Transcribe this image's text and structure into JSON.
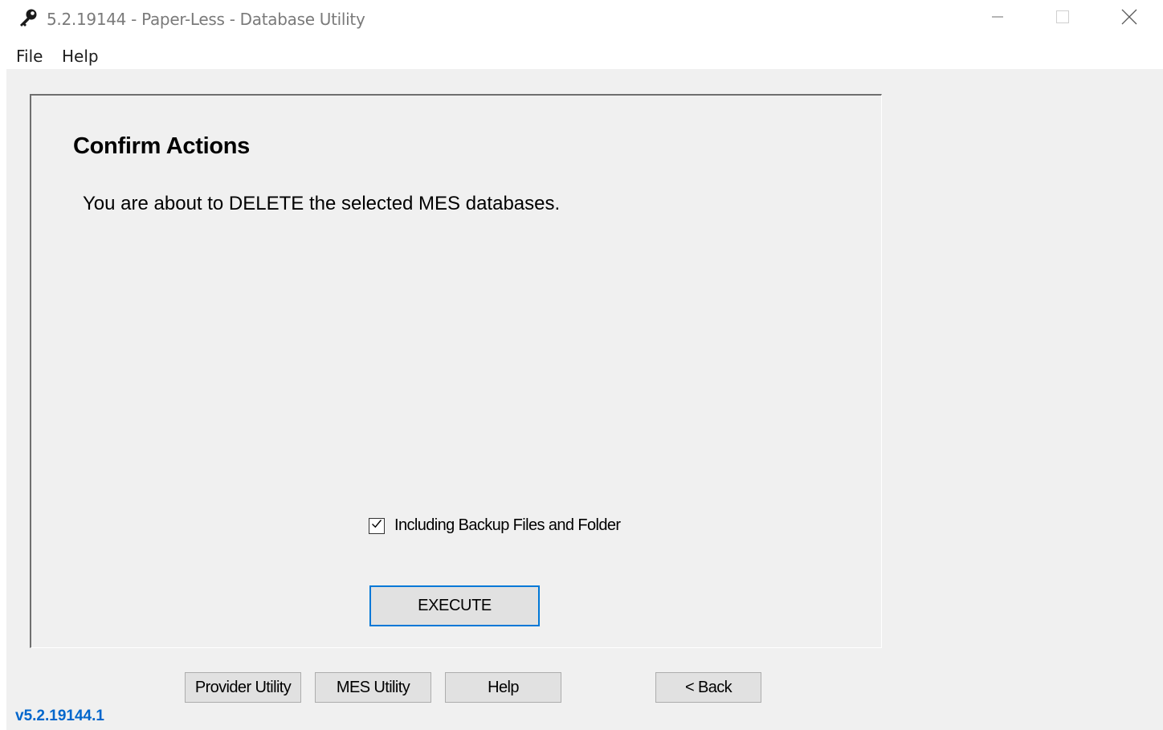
{
  "window": {
    "title": "5.2.19144 - Paper-Less - Database Utility",
    "app_icon": "key-wrench-icon",
    "controls": {
      "minimize_icon": "minimize-icon",
      "maximize_icon": "maximize-icon",
      "close_icon": "close-icon"
    }
  },
  "menubar": {
    "items": [
      {
        "label": "File"
      },
      {
        "label": "Help"
      }
    ]
  },
  "panel": {
    "title": "Confirm Actions",
    "message": "You are about to DELETE the selected MES databases.",
    "checkbox": {
      "label": "Including Backup Files and Folder",
      "checked": true
    },
    "execute_label": "EXECUTE",
    "accent_color": "#0078d7"
  },
  "footer": {
    "buttons": [
      {
        "label": "Provider Utility"
      },
      {
        "label": "MES Utility"
      },
      {
        "label": "Help"
      },
      {
        "label": "< Back"
      }
    ],
    "version": "v5.2.19144.1",
    "version_color": "#0066cc"
  }
}
